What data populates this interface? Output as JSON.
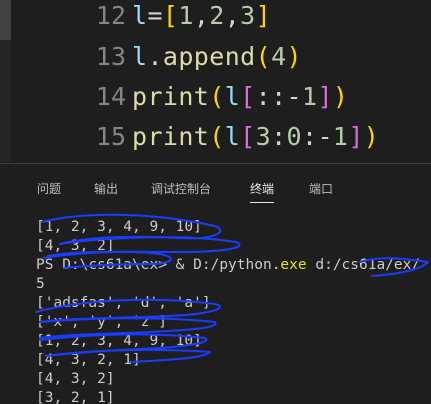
{
  "editor": {
    "lines": [
      {
        "number": "12",
        "tokens": [
          {
            "t": "l",
            "c": "tok-var"
          },
          {
            "t": "=",
            "c": "tok-op"
          },
          {
            "t": "[",
            "c": "tok-b1"
          },
          {
            "t": "1",
            "c": "tok-num"
          },
          {
            "t": ",",
            "c": "tok-punct"
          },
          {
            "t": "2",
            "c": "tok-num"
          },
          {
            "t": ",",
            "c": "tok-punct"
          },
          {
            "t": "3",
            "c": "tok-num"
          },
          {
            "t": "]",
            "c": "tok-b1"
          }
        ]
      },
      {
        "number": "13",
        "tokens": [
          {
            "t": "l",
            "c": "tok-var"
          },
          {
            "t": ".",
            "c": "tok-punct"
          },
          {
            "t": "append",
            "c": "tok-method"
          },
          {
            "t": "(",
            "c": "tok-b1"
          },
          {
            "t": "4",
            "c": "tok-num"
          },
          {
            "t": ")",
            "c": "tok-b1"
          }
        ]
      },
      {
        "number": "14",
        "tokens": [
          {
            "t": "print",
            "c": "tok-fn"
          },
          {
            "t": "(",
            "c": "tok-b1"
          },
          {
            "t": "l",
            "c": "tok-var"
          },
          {
            "t": "[",
            "c": "tok-b2"
          },
          {
            "t": "::",
            "c": "tok-punct"
          },
          {
            "t": "-",
            "c": "tok-op"
          },
          {
            "t": "1",
            "c": "tok-num"
          },
          {
            "t": "]",
            "c": "tok-b2"
          },
          {
            "t": ")",
            "c": "tok-b1"
          }
        ]
      },
      {
        "number": "15",
        "tokens": [
          {
            "t": "print",
            "c": "tok-fn"
          },
          {
            "t": "(",
            "c": "tok-b1"
          },
          {
            "t": "l",
            "c": "tok-var"
          },
          {
            "t": "[",
            "c": "tok-b2"
          },
          {
            "t": "3",
            "c": "tok-num"
          },
          {
            "t": ":",
            "c": "tok-punct"
          },
          {
            "t": "0",
            "c": "tok-num"
          },
          {
            "t": ":",
            "c": "tok-punct"
          },
          {
            "t": "-",
            "c": "tok-op"
          },
          {
            "t": "1",
            "c": "tok-num"
          },
          {
            "t": "]",
            "c": "tok-b2"
          },
          {
            "t": ")",
            "c": "tok-b1"
          }
        ]
      }
    ]
  },
  "panel": {
    "tabs": {
      "problems": "问题",
      "output": "输出",
      "debug_console": "调试控制台",
      "terminal": "终端",
      "ports": "端口"
    },
    "active_tab": "terminal"
  },
  "terminal": {
    "lines": [
      {
        "segments": [
          {
            "t": "[1, 2, 3, 4, 9, 10]"
          }
        ]
      },
      {
        "segments": [
          {
            "t": "[4, 3, 2]"
          }
        ]
      },
      {
        "segments": [
          {
            "t": "PS D:\\cs61a\\ex> & D:/python"
          },
          {
            "t": ".exe",
            "c": "t-yellow"
          },
          {
            "t": " d:/cs61a/ex/"
          }
        ]
      },
      {
        "segments": [
          {
            "t": "5"
          }
        ]
      },
      {
        "segments": [
          {
            "t": "['adsfas', 'd', 'a']"
          }
        ]
      },
      {
        "segments": [
          {
            "t": "['x', 'y', 'z']"
          }
        ]
      },
      {
        "segments": [
          {
            "t": "[1, 2, 3, 4, 9, 10]"
          }
        ]
      },
      {
        "segments": [
          {
            "t": "[4, 3, 2, 1]"
          }
        ]
      },
      {
        "segments": [
          {
            "t": "[4, 3, 2]"
          }
        ]
      },
      {
        "segments": [
          {
            "t": "[3, 2, 1]"
          }
        ]
      }
    ]
  },
  "colors": {
    "background": "#1e1e1e",
    "scribble": "#1a3cff"
  }
}
